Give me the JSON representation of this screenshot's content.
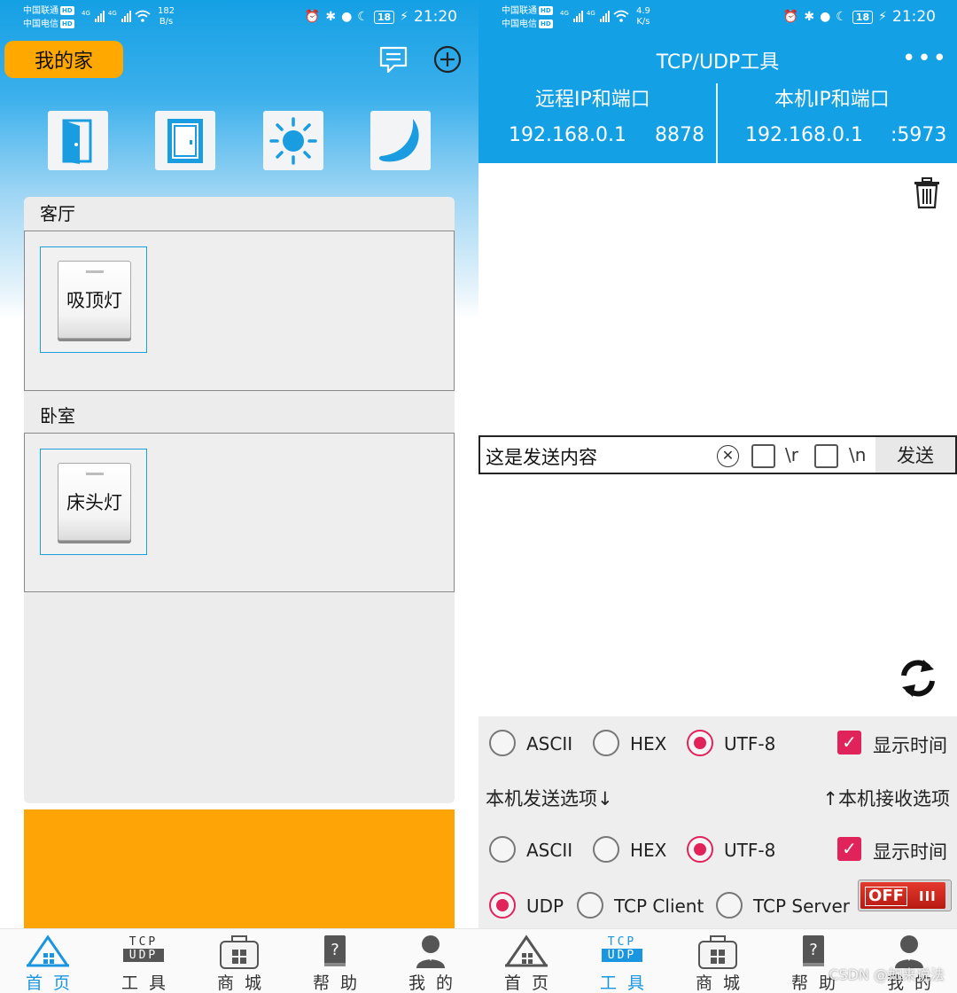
{
  "left": {
    "statusbar": {
      "carrier1": "中国联通",
      "carrier2": "中国电信",
      "hd": "HD",
      "net": "4G",
      "speed_value": "182",
      "speed_unit": "B/s",
      "battery": "18",
      "time": "21:20"
    },
    "header": {
      "home_label": "我的家",
      "message_icon": "message-icon",
      "add_icon": "plus-circle-icon"
    },
    "scenes": [
      {
        "icon": "door-open-icon"
      },
      {
        "icon": "door-closed-icon"
      },
      {
        "icon": "sun-icon"
      },
      {
        "icon": "moon-icon"
      }
    ],
    "rooms": [
      {
        "name": "客厅",
        "devices": [
          {
            "label": "吸顶灯"
          }
        ]
      },
      {
        "name": "卧室",
        "devices": [
          {
            "label": "床头灯"
          }
        ]
      }
    ],
    "banner_color": "#ffa406",
    "nav": [
      {
        "label": "首页",
        "icon": "home-icon",
        "active": true
      },
      {
        "label": "工具",
        "icon": "tcp-udp-icon",
        "badge_top": "TCP",
        "badge_bottom": "UDP",
        "active": false
      },
      {
        "label": "商城",
        "icon": "shop-bag-icon",
        "active": false
      },
      {
        "label": "帮助",
        "icon": "help-book-icon",
        "active": false
      },
      {
        "label": "我的",
        "icon": "user-icon",
        "active": false
      }
    ]
  },
  "right": {
    "statusbar": {
      "carrier1": "中国联通",
      "carrier2": "中国电信",
      "hd": "HD",
      "net": "4G",
      "speed_value": "4.9",
      "speed_unit": "K/s",
      "battery": "18",
      "time": "21:20"
    },
    "title": "TCP/UDP工具",
    "more_icon": "more-dots-icon",
    "remote": {
      "header": "远程IP和端口",
      "ip": "192.168.0.1",
      "port": "8878"
    },
    "local": {
      "header": "本机IP和端口",
      "ip": "192.168.0.1",
      "port": ":5973"
    },
    "send": {
      "value": "这是发送内容",
      "cr_label": "\\r",
      "lf_label": "\\n",
      "cr_checked": false,
      "lf_checked": false,
      "button": "发送"
    },
    "receive_encoding": {
      "options": [
        "ASCII",
        "HEX",
        "UTF-8"
      ],
      "selected": "UTF-8",
      "show_time_label": "显示时间",
      "show_time": true
    },
    "send_options_label": "本机发送选项↓",
    "receive_options_label": "↑本机接收选项",
    "send_encoding": {
      "options": [
        "ASCII",
        "HEX",
        "UTF-8"
      ],
      "selected": "UTF-8",
      "show_time_label": "显示时间",
      "show_time": true
    },
    "protocol": {
      "options": [
        "UDP",
        "TCP Client",
        "TCP Server"
      ],
      "selected": "UDP"
    },
    "connection_toggle": {
      "label": "OFF",
      "bars": "III",
      "on": false
    },
    "accent_color": "#e1235c",
    "nav": [
      {
        "label": "首页",
        "icon": "home-icon",
        "active": false
      },
      {
        "label": "工具",
        "icon": "tcp-udp-icon",
        "badge_top": "TCP",
        "badge_bottom": "UDP",
        "active": true
      },
      {
        "label": "商城",
        "icon": "shop-bag-icon",
        "active": false
      },
      {
        "label": "帮助",
        "icon": "help-book-icon",
        "active": false
      },
      {
        "label": "我的",
        "icon": "user-icon",
        "active": false
      }
    ]
  },
  "watermark": "CSDN @如来说法"
}
